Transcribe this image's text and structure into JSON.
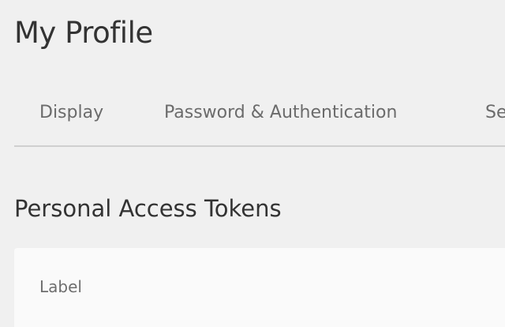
{
  "page": {
    "title": "My Profile"
  },
  "tabs": [
    {
      "label": "Display"
    },
    {
      "label": "Password & Authentication"
    },
    {
      "label": "Se"
    }
  ],
  "section": {
    "title": "Personal Access Tokens"
  },
  "tokens_table": {
    "columns": [
      "Label"
    ]
  },
  "colors": {
    "background": "#f0f0f0",
    "card": "#fafafa",
    "divider": "#cfcfcf",
    "text": "#333333",
    "muted": "#6b6b6b"
  }
}
